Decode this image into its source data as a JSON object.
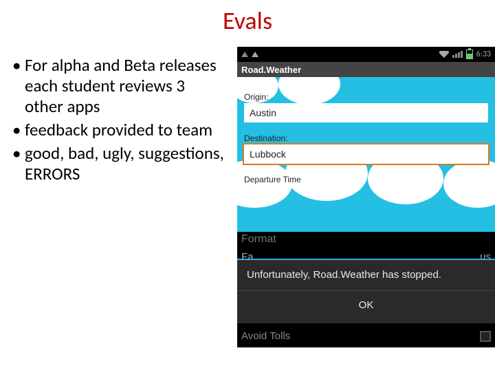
{
  "title": "Evals",
  "bullets": [
    "For alpha and Beta releases each student reviews 3 other apps",
    "feedback provided to team",
    "good, bad, ugly, suggestions, ERRORS"
  ],
  "phone": {
    "statusbar": {
      "time": "6:33"
    },
    "appbar": {
      "title": "Road.Weather"
    },
    "form": {
      "origin_label": "Origin:",
      "origin_value": "Austin",
      "destination_label": "Destination:",
      "destination_value": "Lubbock",
      "departure_label": "Departure Time"
    },
    "settings": {
      "format": "Format",
      "fahrenheit": "Fa",
      "celsius_suffix": "us",
      "avoid_tolls": "Avoid Tolls"
    },
    "dialog": {
      "message": "Unfortunately, Road.Weather has stopped.",
      "ok": "OK"
    }
  }
}
